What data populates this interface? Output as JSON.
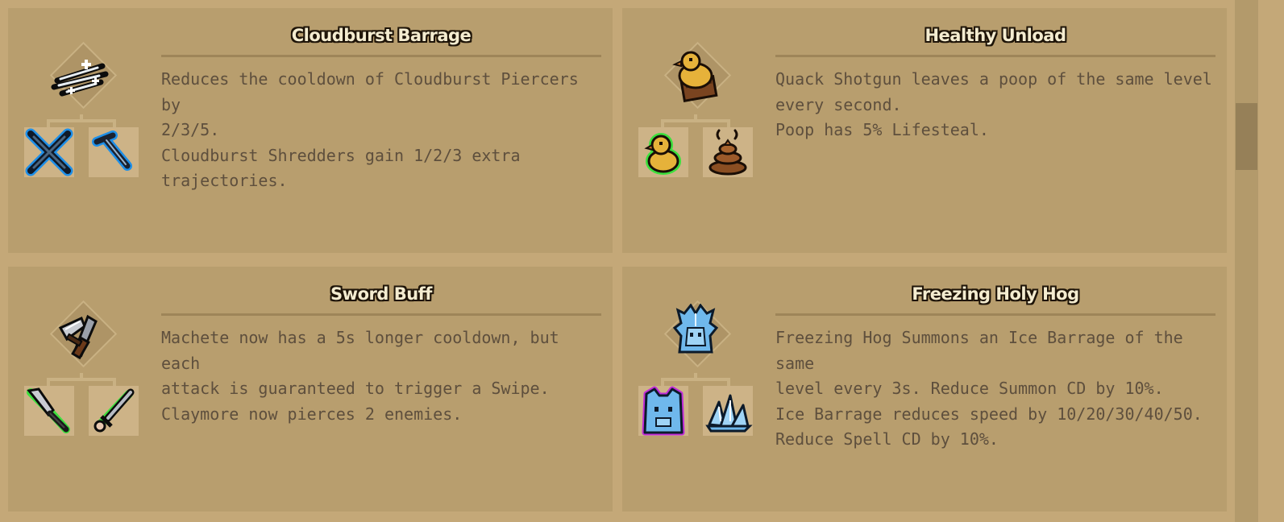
{
  "cards": [
    {
      "title": "Cloudburst Barrage",
      "description": [
        "Reduces the cooldown of Cloudburst Piercers by",
        "2/3/5.",
        "Cloudburst Shredders gain 1/2/3 extra",
        "trajectories."
      ],
      "icons": {
        "result": "cloudburst-barrage-icon",
        "left": "crossed-blades-icon",
        "right": "cloudburst-piercer-icon"
      },
      "ingredient_outlines": [
        "#1e8fe8",
        "#1e8fe8"
      ]
    },
    {
      "title": "Healthy Unload",
      "description": [
        "Quack Shotgun leaves a poop of the same level",
        "every second.",
        "Poop has 5% Lifesteal."
      ],
      "icons": {
        "result": "duck-on-crate-icon",
        "left": "rubber-duck-icon",
        "right": "poop-icon"
      },
      "ingredient_outlines": [
        "#3ce03c",
        "none"
      ]
    },
    {
      "title": "Sword Buff",
      "description": [
        "Machete now has a 5s longer cooldown, but each",
        "attack is guaranteed to trigger a Swipe.",
        "Claymore now pierces 2 enemies."
      ],
      "icons": {
        "result": "crossed-swords-icon",
        "left": "machete-icon",
        "right": "claymore-icon"
      },
      "ingredient_outlines": [
        "#3ce03c",
        "#3ce03c"
      ]
    },
    {
      "title": "Freezing Holy Hog",
      "description": [
        "Freezing Hog Summons an Ice Barrage of the same",
        "level every 3s. Reduce Summon CD by 10%.",
        "Ice Barrage reduces speed by 10/20/30/40/50.",
        "Reduce Spell CD by 10%."
      ],
      "icons": {
        "result": "ice-hog-icon",
        "left": "freezing-hog-icon",
        "right": "ice-crystal-icon"
      },
      "ingredient_outlines": [
        "#c02cd8",
        "none"
      ]
    }
  ],
  "colors": {
    "page_background": "#c4a878",
    "card_background": "#b89e6e",
    "title_text": "#f4ecd0",
    "description_text": "#5e4f3d",
    "scroll_thumb": "#968058"
  }
}
